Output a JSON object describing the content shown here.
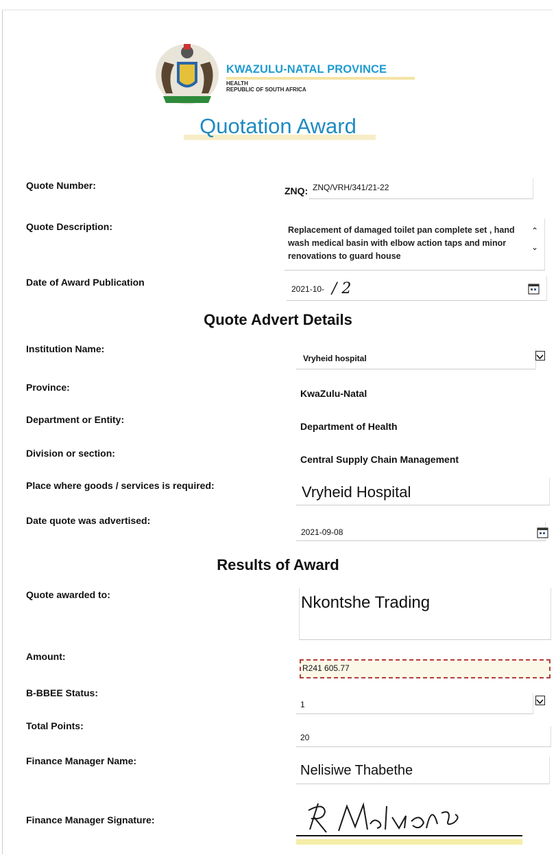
{
  "header": {
    "province_title": "KWAZULU-NATAL PROVINCE",
    "dept": "HEALTH",
    "country": "REPUBLIC OF SOUTH AFRICA",
    "doc_title": "Quotation Award"
  },
  "quote": {
    "number_label": "Quote Number:",
    "number_prefix": "ZNQ:",
    "number_value": "ZNQ/VRH/341/21-22",
    "description_label": "Quote Description:",
    "description_value": "Replacement of damaged toilet pan complete set , hand wash medical basin with elbow action taps and minor renovations to guard house",
    "award_date_label": "Date of Award Publication",
    "award_date_value": "2021-10-",
    "award_date_handwritten": "/ 2"
  },
  "advert": {
    "heading": "Quote Advert Details",
    "institution_label": "Institution Name:",
    "institution_value": "Vryheid hospital",
    "province_label": "Province:",
    "province_value": "KwaZulu-Natal",
    "department_label": "Department or Entity:",
    "department_value": "Department of Health",
    "division_label": "Division or section:",
    "division_value": "Central Supply Chain Management",
    "place_label": "Place where goods /  services is required:",
    "place_value": "Vryheid Hospital",
    "advertised_label": "Date quote was advertised:",
    "advertised_value": "2021-09-08"
  },
  "results": {
    "heading": "Results of Award",
    "awarded_label": "Quote awarded to:",
    "awarded_value": "Nkontshe Trading",
    "amount_label": "Amount:",
    "amount_value": "R241 605.77",
    "bbbee_label": "B-BBEE Status:",
    "bbbee_value": "1",
    "points_label": "Total Points:",
    "points_value": "20",
    "fm_name_label": "Finance Manager Name:",
    "fm_name_value": "Nelisiwe Thabethe",
    "fm_sig_label": "Finance Manager Signature:"
  },
  "colors": {
    "accent": "#1f8ac2",
    "amount_border": "#b43c3c"
  }
}
